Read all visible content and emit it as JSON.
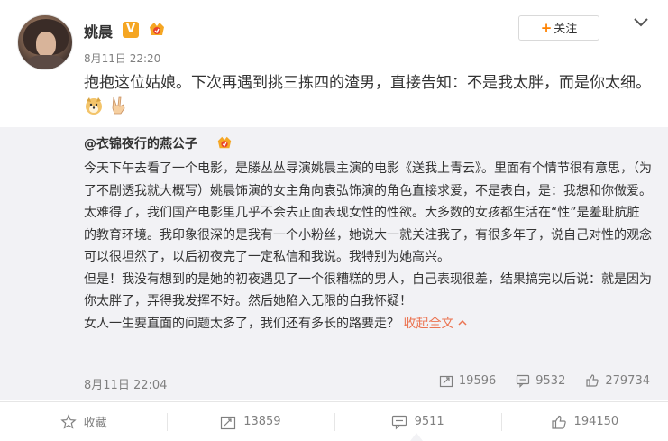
{
  "post": {
    "author": "姚晨",
    "verified_badge": "V",
    "time": "8月11日 22:20",
    "follow_label": "关注",
    "text": "抱抱这位姑娘。下次再遇到挑三拣四的渣男，直接告知：不是我太胖，而是你太细。",
    "emojis": [
      "doge-emoji-icon",
      "victory-hand-icon"
    ]
  },
  "repost": {
    "author": "@衣锦夜行的燕公子",
    "paragraphs": [
      "今天下午去看了一个电影，是滕丛丛导演姚晨主演的电影《送我上青云》。里面有个情节很有意思，（为了不剧透我就大概写）姚晨饰演的女主角向袁弘饰演的角色直接求爱，不是表白，是：我想和你做爱。",
      "太难得了，我们国产电影里几乎不会去正面表现女性的性欲。大多数的女孩都生活在“性”是羞耻肮脏的教育环境。我印象很深的是我有一个小粉丝，她说大一就关注我了，有很多年了，说自己对性的观念可以很坦然了，以后初夜完了一定私信和我说。我特别为她高兴。",
      "但是！我没有想到的是她的初夜遇见了一个很糟糕的男人，自己表现很差，结果搞完以后说：就是因为你太胖了，弄得我发挥不好。然后她陷入无限的自我怀疑！",
      "女人一生要直面的问题太多了，我们还有多长的路要走？"
    ],
    "collapse_label": "收起全文",
    "time": "8月11日 22:04",
    "reposts": "19596",
    "comments": "9532",
    "likes": "279734"
  },
  "actions": {
    "favorite_label": "收藏",
    "repost_count": "13859",
    "comment_count": "9511",
    "like_count": "194150"
  },
  "colors": {
    "accent_orange": "#ff8200",
    "link": "#eb7350",
    "repost_bg": "#f2f2f5",
    "meta_gray": "#808080"
  }
}
